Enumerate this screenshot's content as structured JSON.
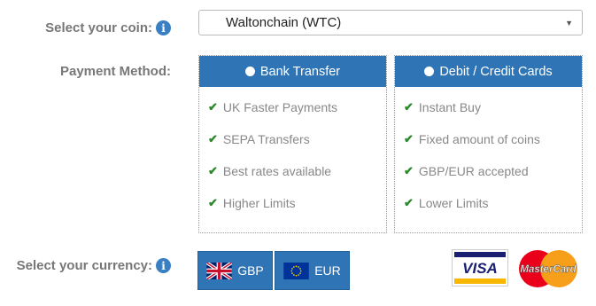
{
  "coin": {
    "label": "Select your coin:",
    "selected": "Waltonchain (WTC)",
    "info_icon": "info-icon"
  },
  "payment": {
    "label": "Payment Method:",
    "options": [
      {
        "title": "Bank Transfer",
        "selected": true,
        "features": [
          "UK Faster Payments",
          "SEPA Transfers",
          "Best rates available",
          "Higher Limits"
        ]
      },
      {
        "title": "Debit / Credit Cards",
        "selected": false,
        "features": [
          "Instant Buy",
          "Fixed amount of coins",
          "GBP/EUR accepted",
          "Lower Limits"
        ]
      }
    ]
  },
  "currency": {
    "label": "Select your currency:",
    "info_icon": "info-icon",
    "options": [
      {
        "code": "GBP",
        "flag": "uk-flag-icon"
      },
      {
        "code": "EUR",
        "flag": "eu-flag-icon"
      }
    ]
  },
  "cards": {
    "visa_text": "VISA",
    "mastercard_text": "MasterCard"
  },
  "colors": {
    "accent": "#2f75b5",
    "check": "#2c8a2c",
    "label": "#777777"
  }
}
